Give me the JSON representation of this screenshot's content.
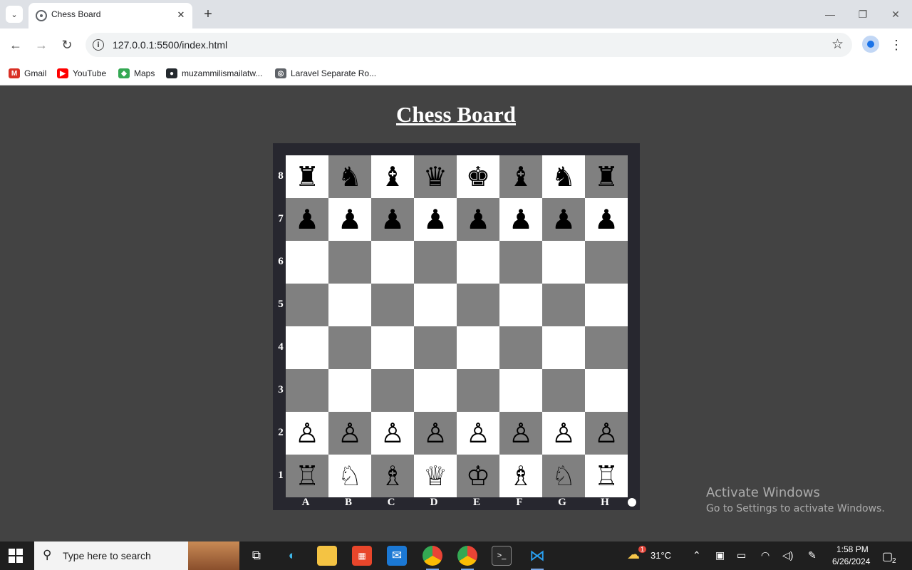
{
  "browser": {
    "tab_title": "Chess Board",
    "url": "127.0.0.1:5500/index.html",
    "bookmarks": [
      {
        "label": "Gmail",
        "icon": "gmail-icon",
        "color": "#d93025",
        "glyph": "M"
      },
      {
        "label": "YouTube",
        "icon": "youtube-icon",
        "color": "#ff0000",
        "glyph": "▶"
      },
      {
        "label": "Maps",
        "icon": "maps-icon",
        "color": "#34a853",
        "glyph": "◆"
      },
      {
        "label": "muzammilismailatw...",
        "icon": "github-icon",
        "color": "#24292e",
        "glyph": "●"
      },
      {
        "label": "Laravel Separate Ro...",
        "icon": "globe-icon",
        "color": "#5f6368",
        "glyph": "◎"
      }
    ]
  },
  "page": {
    "title": "Chess Board",
    "colors": {
      "light_square": "#ffffff",
      "dark_square": "#808080",
      "frame": "#27272f",
      "background": "#434343"
    },
    "ranks": [
      "8",
      "7",
      "6",
      "5",
      "4",
      "3",
      "2",
      "1"
    ],
    "files": [
      "A",
      "B",
      "C",
      "D",
      "E",
      "F",
      "G",
      "H"
    ],
    "board": [
      [
        "♜",
        "♞",
        "♝",
        "♛",
        "♚",
        "♝",
        "♞",
        "♜"
      ],
      [
        "♟",
        "♟",
        "♟",
        "♟",
        "♟",
        "♟",
        "♟",
        "♟"
      ],
      [
        "",
        "",
        "",
        "",
        "",
        "",
        "",
        ""
      ],
      [
        "",
        "",
        "",
        "",
        "",
        "",
        "",
        ""
      ],
      [
        "",
        "",
        "",
        "",
        "",
        "",
        "",
        ""
      ],
      [
        "",
        "",
        "",
        "",
        "",
        "",
        "",
        ""
      ],
      [
        "♙",
        "♙",
        "♙",
        "♙",
        "♙",
        "♙",
        "♙",
        "♙"
      ],
      [
        "♖",
        "♘",
        "♗",
        "♕",
        "♔",
        "♗",
        "♘",
        "♖"
      ]
    ],
    "watermark_title": "Activate Windows",
    "watermark_text": "Go to Settings to activate Windows."
  },
  "taskbar": {
    "search_placeholder": "Type here to search",
    "temperature": "31°C",
    "weather_badge": "1",
    "time": "1:58 PM",
    "date": "6/26/2024",
    "notification_count": "2"
  }
}
